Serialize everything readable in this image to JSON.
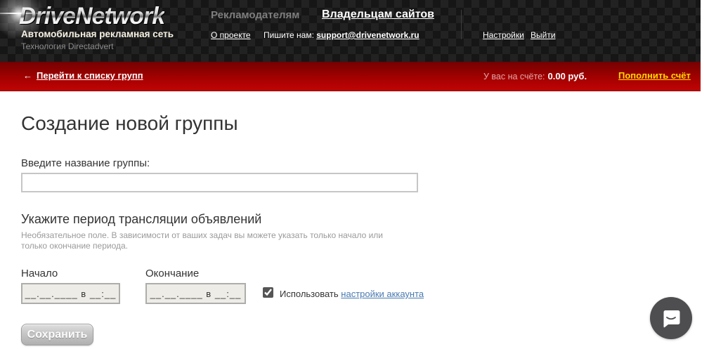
{
  "header": {
    "logo": {
      "title": "DriveNetwork",
      "subtitle": "Автомобильная рекламная сеть",
      "tagline": "Технология Directadvert"
    },
    "nav": {
      "advertisers": "Рекламодателям",
      "site_owners": "Владельцам сайтов",
      "about": "О проекте",
      "contact_prefix": "Пишите нам: ",
      "contact_email": "support@drivenetwork.ru",
      "settings": "Настройки",
      "logout": "Выйти"
    }
  },
  "balance_bar": {
    "back_arrow": "←",
    "back_link": "Перейти к списку групп",
    "balance_label": "У вас на счёте:",
    "balance_value": "0.00 руб.",
    "topup_link": "Пополнить счёт"
  },
  "form": {
    "title": "Создание новой группы",
    "name_label": "Введите название группы:",
    "name_value": "",
    "period_title": "Укажите период трансляции объявлений",
    "period_hint": "Необязательное поле. В зависимости от ваших задач вы можете указать только начало или только окончание периода.",
    "start_label": "Начало",
    "end_label": "Окончание",
    "date_mask": "__.__.____ в __:__",
    "checkbox_checked": true,
    "checkbox_label": "Использовать ",
    "checkbox_link": "настройки аккаунта",
    "save_button": "Сохранить"
  },
  "colors": {
    "accent_red": "#b00000",
    "topup_yellow": "#ffd800",
    "link_blue": "#4a7ab0"
  }
}
